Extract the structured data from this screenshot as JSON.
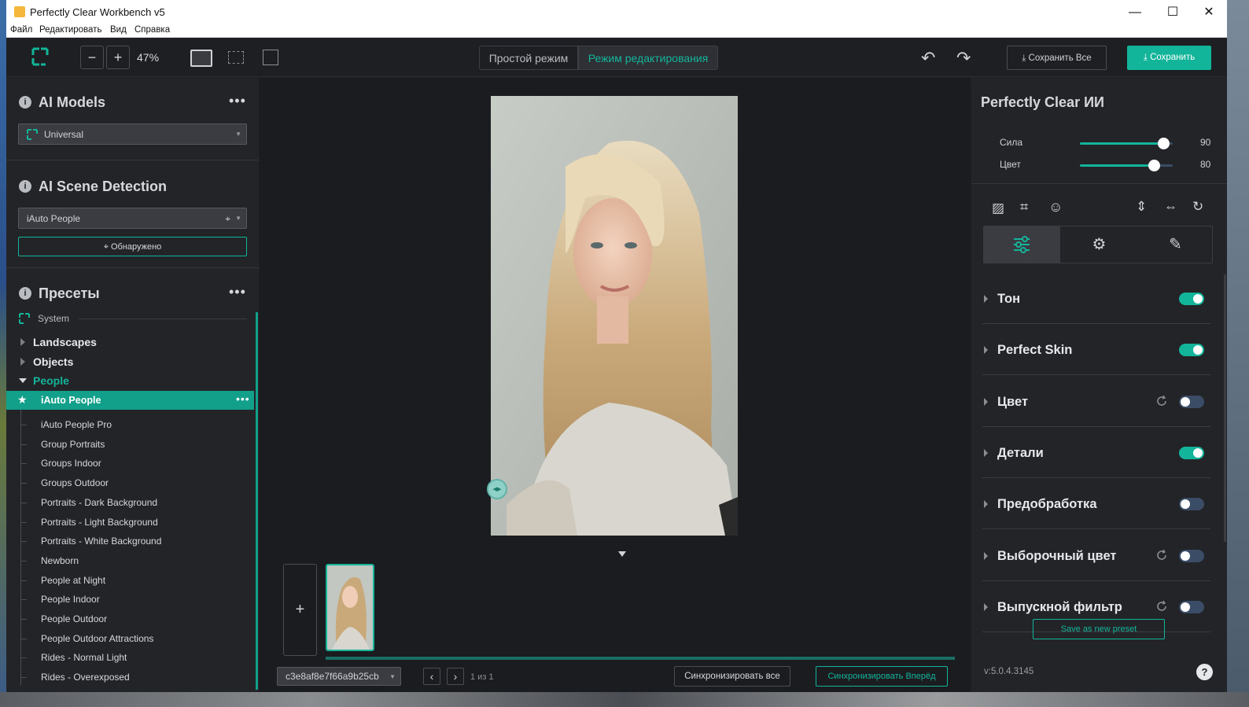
{
  "window": {
    "title": "Perfectly Clear Workbench v5",
    "controls": {
      "minimize": "—",
      "maximize": "☐",
      "close": "✕"
    }
  },
  "menu": [
    "Файл",
    "Редактировать",
    "Вид",
    "Справка"
  ],
  "toolbar": {
    "zoom_minus": "−",
    "zoom_plus": "+",
    "zoom_value": "47%",
    "mode_simple": "Простой режим",
    "mode_edit": "Режим редактирования",
    "save_all": "Сохранить Все",
    "save": "Сохранить"
  },
  "left": {
    "ai_models": {
      "title": "AI Models",
      "selected": "Universal"
    },
    "scene": {
      "title": "AI Scene Detection",
      "selected": "iAuto People",
      "detected_button": "Обнаружено"
    },
    "presets": {
      "title": "Пресеты",
      "source": "System",
      "groups": [
        "Landscapes",
        "Objects",
        "People"
      ],
      "active_item": "iAuto People",
      "items": [
        "iAuto People Pro",
        "Group Portraits",
        "Groups Indoor",
        "Groups Outdoor",
        "Portraits - Dark Background",
        "Portraits - Light Background",
        "Portraits - White Background",
        "Newborn",
        "People at Night",
        "People Indoor",
        "People Outdoor",
        "People Outdoor Attractions",
        "Rides - Normal Light",
        "Rides - Overexposed"
      ]
    }
  },
  "canvas": {
    "add_label": "+",
    "file_name": "c3e8af8e7f66a9b25cb",
    "pager": "1 из 1",
    "sync_all": "Синхронизировать все",
    "sync_forward": "Синхронизировать Вперёд"
  },
  "right": {
    "title": "Perfectly Clear ИИ",
    "sliders": [
      {
        "label": "Сила",
        "value": 90,
        "fraction": 0.9
      },
      {
        "label": "Цвет",
        "value": 80,
        "fraction": 0.8
      }
    ],
    "adjustments": [
      {
        "label": "Тон",
        "on": true,
        "reset": false
      },
      {
        "label": "Perfect Skin",
        "on": true,
        "reset": false
      },
      {
        "label": "Цвет",
        "on": false,
        "reset": true
      },
      {
        "label": "Детали",
        "on": true,
        "reset": false
      },
      {
        "label": "Предобработка",
        "on": false,
        "reset": false
      },
      {
        "label": "Выборочный цвет",
        "on": false,
        "reset": true
      },
      {
        "label": "Выпускной фильтр",
        "on": false,
        "reset": true
      }
    ],
    "save_preset": "Save as new preset",
    "version": "v:5.0.4.3145",
    "help": "?"
  },
  "colors": {
    "accent": "#13b59a",
    "panel": "#232428",
    "canvas": "#1b1c20"
  }
}
